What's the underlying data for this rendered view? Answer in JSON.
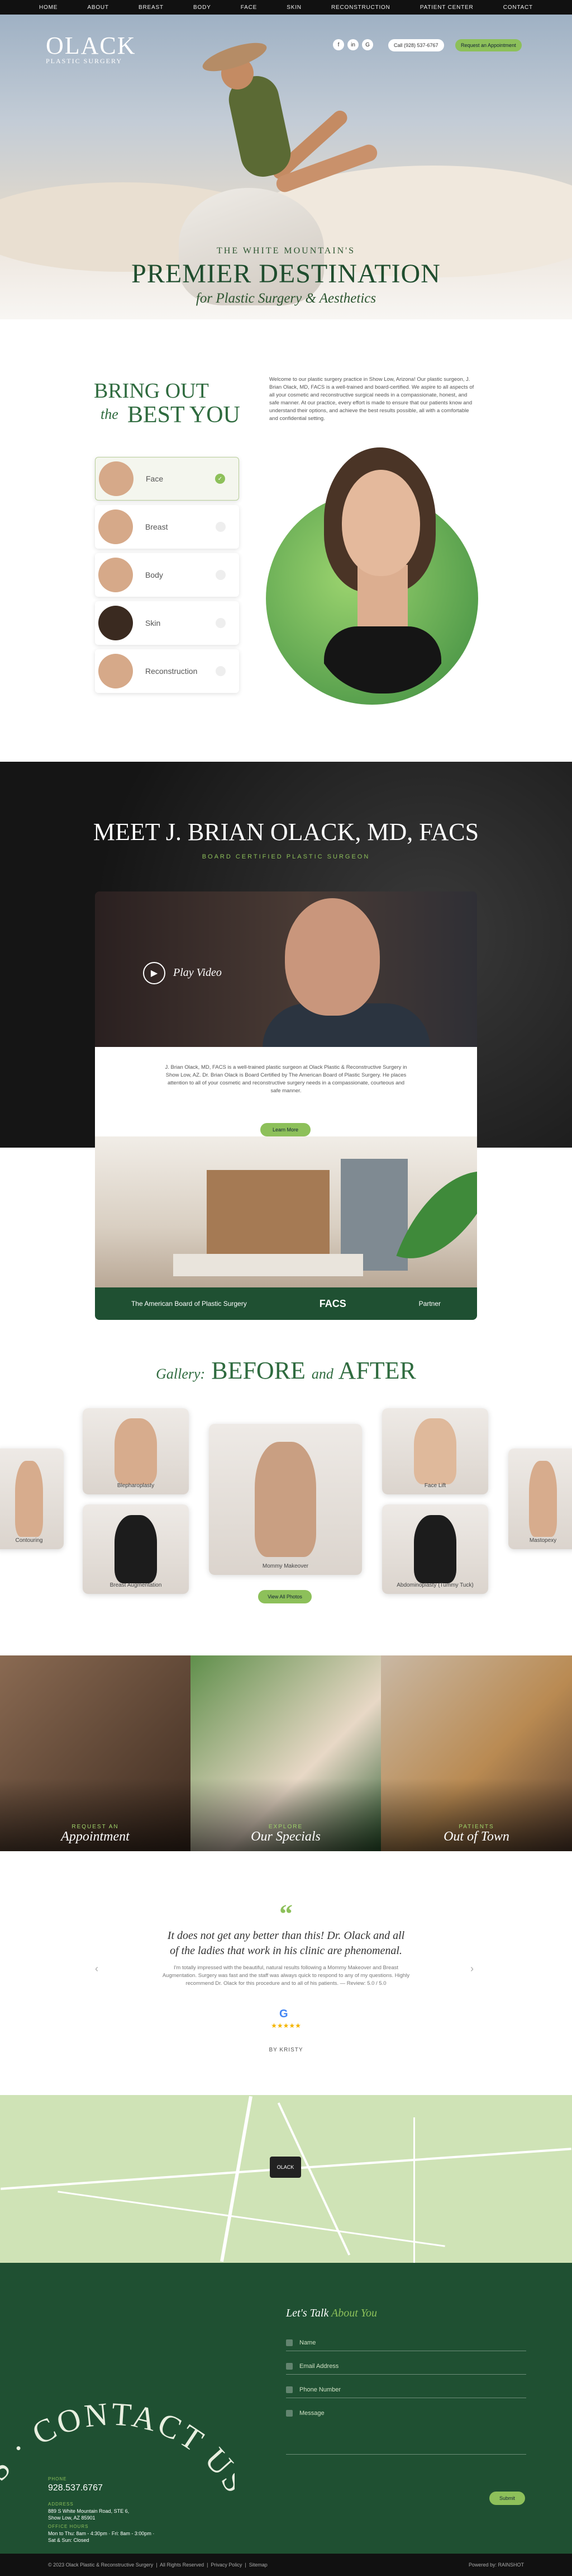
{
  "nav": [
    "HOME",
    "ABOUT",
    "BREAST",
    "BODY",
    "FACE",
    "SKIN",
    "RECONSTRUCTION",
    "PATIENT CENTER",
    "CONTACT"
  ],
  "logo": {
    "name": "OLACK",
    "sub": "PLASTIC SURGERY"
  },
  "header": {
    "call": "Call (928) 537-6767",
    "appt": "Request an Appointment",
    "social": [
      "f",
      "in",
      "G"
    ]
  },
  "hero": {
    "sub": "THE WHITE MOUNTAIN'S",
    "title": "PREMIER DESTINATION",
    "tag": "for Plastic Surgery & Aesthetics"
  },
  "intro": {
    "heading1": "BRING OUT",
    "the": "the",
    "heading2": "BEST YOU",
    "text": "Welcome to our plastic surgery practice in Show Low, Arizona! Our plastic surgeon, J. Brian Olack, MD, FACS is a well-trained and board-certified. We aspire to all aspects of all your cosmetic and reconstructive surgical needs in a compassionate, honest, and safe manner. At our practice, every effort is made to ensure that our patients know and understand their options, and achieve the best results possible, all with a comfortable and confidential setting.",
    "categories": [
      {
        "label": "Face",
        "active": true
      },
      {
        "label": "Breast"
      },
      {
        "label": "Body"
      },
      {
        "label": "Skin"
      },
      {
        "label": "Reconstruction"
      }
    ]
  },
  "meet": {
    "title": "MEET J. BRIAN OLACK, MD, FACS",
    "sub": "BOARD CERTIFIED PLASTIC SURGEON",
    "play": "Play Video",
    "bio": "J. Brian Olack, MD, FACS is a well-trained plastic surgeon at Olack Plastic & Reconstructive Surgery in Show Low, AZ. Dr. Brian Olack is Board Certified by The American Board of Plastic Surgery. He places attention to all of your cosmetic and reconstructive surgery needs in a compassionate, courteous and safe manner.",
    "learn": "Learn More",
    "creds": [
      "The American Board of Plastic Surgery",
      "FACS",
      "Partner"
    ]
  },
  "gallery": {
    "title_pre": "Gallery:",
    "title_a": "BEFORE",
    "and": "and",
    "title_b": "AFTER",
    "items": [
      "Contouring",
      "Blepharoplasty",
      "Breast Augmentation",
      "Mommy Makeover",
      "Face Lift",
      "Abdominoplasty (Tummy Tuck)",
      "Mastopexy"
    ],
    "view_all": "View All Photos"
  },
  "tiles": [
    {
      "pre": "REQUEST AN",
      "title": "Appointment",
      "color": "#5a3d2b"
    },
    {
      "pre": "EXPLORE",
      "title": "Our Specials",
      "color": "#5f7f4b"
    },
    {
      "pre": "PATIENTS",
      "title": "Out of Town",
      "color": "#a57a4f"
    }
  ],
  "testimonial": {
    "quote": "It does not get any better than this! Dr. Olack and all of the ladies that work in his clinic are phenomenal.",
    "body": "I'm totally impressed with the beautiful, natural results following a Mommy Makeover and Breast Augmentation. Surgery was fast and the staff was always quick to respond to any of my questions. Highly recommend Dr. Olack for this procedure and to all of his patients. — Review: 5.0 / 5.0",
    "stars": "★★★★★",
    "author": "BY KRISTY"
  },
  "map": {
    "marker": "OLACK"
  },
  "contact": {
    "pre": "Let's Talk",
    "accent": "About You",
    "fields": [
      "Name",
      "Email Address",
      "Phone Number",
      "Message"
    ],
    "submit": "Submit",
    "arc": "US · CONTACT US · CO",
    "phone_h": "PHONE",
    "phone": "928.537.6767",
    "address_h": "ADDRESS",
    "address": "889 S White Mountain Road, STE 6, Show Low, AZ 85901",
    "hours_h": "OFFICE HOURS",
    "hours": "Mon to Thu: 8am - 4:30pm · Fri: 8am - 3:00pm · Sat & Sun: Closed"
  },
  "footer": {
    "left": "© 2023 Olack Plastic & Reconstructive Surgery  |  All Rights Reserved  |  Privacy Policy  |  Sitemap",
    "right": "Powered by: RAINSHOT"
  }
}
